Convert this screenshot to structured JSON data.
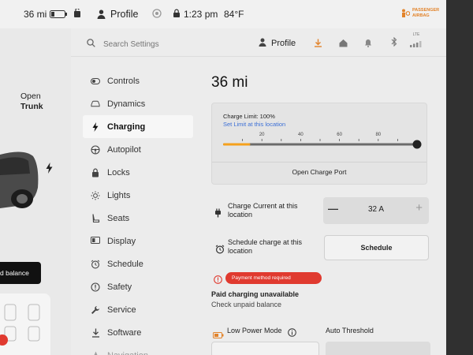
{
  "status_bar": {
    "range": "36 mi",
    "profile_label": "Profile",
    "time": "1:23 pm",
    "temperature": "84°F",
    "airbag_line1": "PASSENGER",
    "airbag_line2": "AIRBAG"
  },
  "car_panel": {
    "trunk_line1": "Open",
    "trunk_line2": "Trunk",
    "toast_text": "d balance"
  },
  "header": {
    "search_placeholder": "Search Settings",
    "profile_label": "Profile",
    "lte_label": "LTE"
  },
  "nav": {
    "items": [
      {
        "label": "Controls",
        "icon": "toggle-icon"
      },
      {
        "label": "Dynamics",
        "icon": "car-icon"
      },
      {
        "label": "Charging",
        "icon": "bolt-icon"
      },
      {
        "label": "Autopilot",
        "icon": "steering-wheel-icon"
      },
      {
        "label": "Locks",
        "icon": "lock-icon"
      },
      {
        "label": "Lights",
        "icon": "light-icon"
      },
      {
        "label": "Seats",
        "icon": "seat-icon"
      },
      {
        "label": "Display",
        "icon": "display-icon"
      },
      {
        "label": "Schedule",
        "icon": "alarm-clock-icon"
      },
      {
        "label": "Safety",
        "icon": "safety-icon"
      },
      {
        "label": "Service",
        "icon": "wrench-icon"
      },
      {
        "label": "Software",
        "icon": "download-icon"
      },
      {
        "label": "Navigation",
        "icon": "navigation-icon"
      }
    ],
    "active_index": 2
  },
  "charging": {
    "range_label": "36 mi",
    "charge_limit_label": "Charge Limit: 100%",
    "set_limit_link": "Set Limit at this location",
    "tick_labels": [
      "20",
      "40",
      "60",
      "80"
    ],
    "battery_level_percent": 14,
    "charge_limit_percent": 100,
    "open_port_label": "Open Charge Port",
    "current_label": "Charge Current at this location",
    "current_value": "32 A",
    "minus_symbol": "—",
    "plus_symbol": "+",
    "schedule_label": "Schedule charge at this location",
    "schedule_button": "Schedule",
    "payment_badge": "Payment method required",
    "paid_unavailable": "Paid charging unavailable",
    "check_balance": "Check unpaid balance",
    "low_power_label": "Low Power Mode",
    "auto_threshold_label": "Auto Threshold"
  },
  "colors": {
    "accent_blue": "#3b6fd6",
    "error_red": "#e03a2f",
    "charge_orange": "#f5a11c"
  }
}
